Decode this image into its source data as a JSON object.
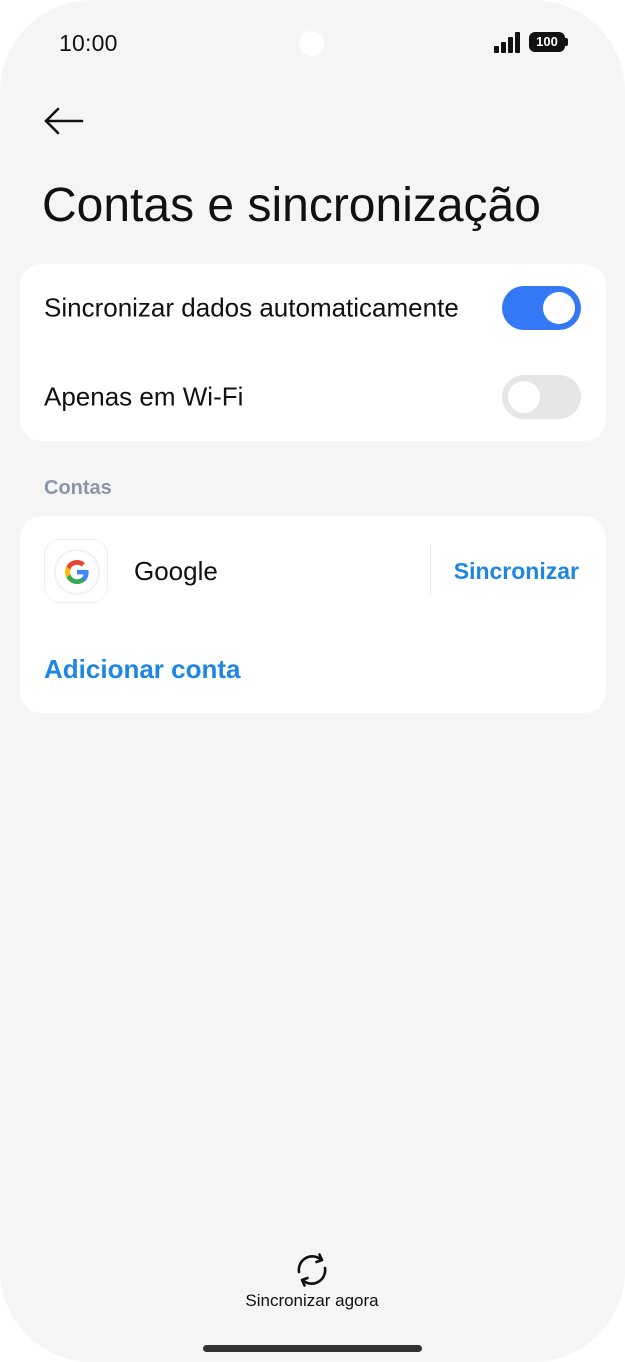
{
  "status_bar": {
    "time": "10:00",
    "battery_level": "100",
    "icons": [
      "signal-icon",
      "battery-icon"
    ]
  },
  "header": {
    "back_icon": "arrow-left-icon",
    "title": "Contas e sincronização"
  },
  "sync_settings": {
    "auto_sync": {
      "label": "Sincronizar dados automaticamente",
      "enabled": true
    },
    "wifi_only": {
      "label": "Apenas em Wi-Fi",
      "enabled": false
    }
  },
  "accounts_section": {
    "header": "Contas",
    "accounts": [
      {
        "name": "Google",
        "icon": "google-icon",
        "action_label": "Sincronizar"
      }
    ],
    "add_account_label": "Adicionar conta"
  },
  "footer": {
    "sync_now_label": "Sincronizar agora",
    "sync_now_icon": "sync-icon"
  },
  "colors": {
    "accent": "#1f86e3",
    "toggle_on": "#3478f6",
    "toggle_off": "#e6e6e6",
    "section_header": "#8a94aa",
    "background": "#f5f5f5"
  }
}
